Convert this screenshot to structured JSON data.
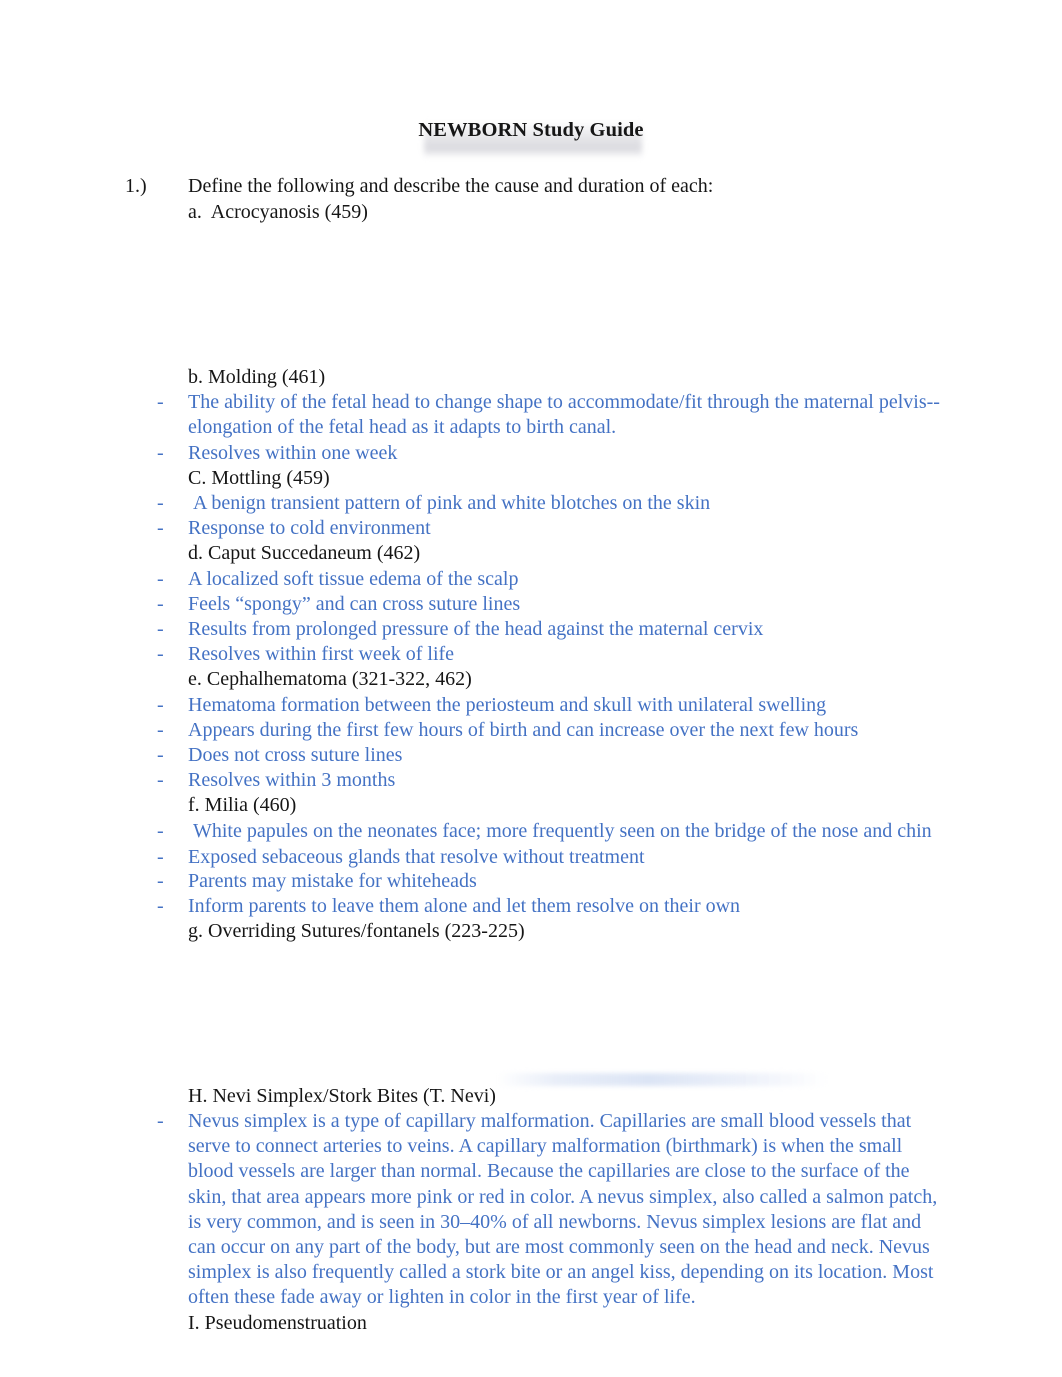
{
  "document": {
    "title": "NEWBORN Study Guide"
  },
  "colors": {
    "body_black": "#161616",
    "accent_blue": "#4472C4",
    "page_background": "#ffffff"
  },
  "content": {
    "question_number": "1.)",
    "question_text": "Define the following and describe the cause and duration of each:",
    "items": [
      {
        "heading": "a.  Acrocyanosis (459)",
        "bullets": []
      },
      {
        "heading": "b. Molding (461)",
        "bullets": [
          "The ability of the fetal head to change shape to accommodate/fit through the maternal pelvis--elongation of the fetal head as it adapts to birth canal.",
          "Resolves within one week"
        ]
      },
      {
        "heading": "C. Mottling (459)",
        "bullets": [
          " A benign transient pattern of pink and white blotches on the skin",
          "Response to cold environment"
        ]
      },
      {
        "heading": "d. Caput Succedaneum (462)",
        "bullets": [
          "A localized soft tissue edema of the scalp",
          "Feels “spongy” and can cross suture lines",
          "Results from prolonged pressure of the head against the maternal cervix",
          "Resolves within first week of life"
        ]
      },
      {
        "heading": "e. Cephalhematoma (321-322, 462)",
        "bullets": [
          "Hematoma formation between the periosteum and skull with unilateral swelling",
          "Appears during the first few hours of birth and can increase over the next few hours",
          "Does not cross suture lines",
          "Resolves within 3 months"
        ]
      },
      {
        "heading": "f. Milia (460)",
        "bullets": [
          " White papules on the neonates face; more frequently seen on the bridge of the nose and chin",
          "Exposed sebaceous glands that resolve without treatment",
          "Parents may mistake for whiteheads",
          "Inform parents to leave them alone and let them resolve on their own"
        ]
      },
      {
        "heading": "g. Overriding Sutures/fontanels (223-225)",
        "bullets": []
      },
      {
        "heading": "H. Nevi Simplex/Stork Bites (T. Nevi)",
        "bullets": [
          "Nevus simplex is a type of capillary malformation. Capillaries are small blood vessels that serve to connect arteries to veins. A capillary malformation (birthmark) is when the small blood vessels are larger than normal. Because the capillaries are close to the surface of the skin, that area appears more pink or red in color. A nevus simplex, also called a salmon patch, is very common, and is seen in 30–40% of all newborns. Nevus simplex lesions are flat and can occur on any part of the body, but are most commonly seen on the head and neck. Nevus simplex is also frequently called a stork bite or an angel kiss, depending on its location. Most often these fade away or lighten in color in the first year of life."
        ]
      },
      {
        "heading": "I. Pseudomenstruation",
        "bullets": []
      }
    ],
    "dash_marker": "-"
  }
}
